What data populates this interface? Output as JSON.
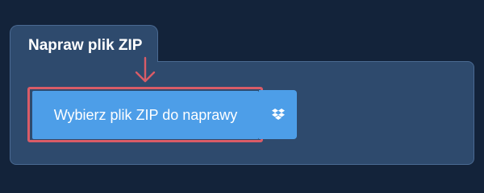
{
  "panel": {
    "tab_title": "Napraw plik ZIP"
  },
  "upload": {
    "select_label": "Wybierz plik ZIP do naprawy",
    "dropbox_icon": "dropbox-icon"
  },
  "colors": {
    "background": "#13233a",
    "panel": "#2e4a6d",
    "button": "#4d9ee8",
    "highlight": "#d95c67"
  }
}
